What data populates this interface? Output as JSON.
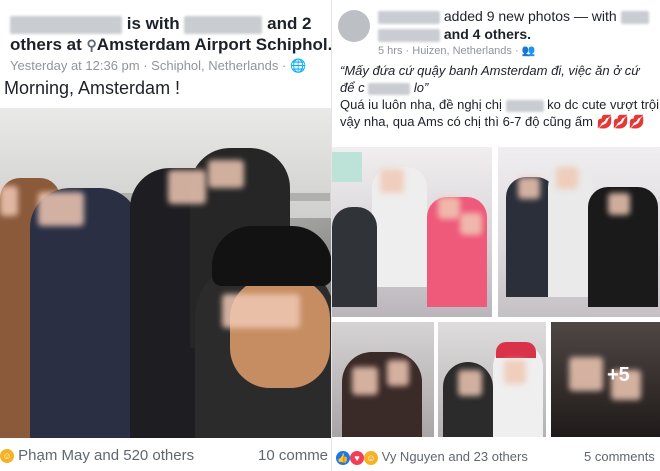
{
  "left_post": {
    "header_with": "is with",
    "header_and": "and 2",
    "header_others": "others at",
    "location": "Amsterdam Airport Schiphol.",
    "timestamp": "Yesterday at 12:36 pm",
    "place": "Schiphol, Netherlands",
    "body": "Morning, Amsterdam !",
    "reactions_text": "Phạm May and 520 others",
    "comments_text": "10 comme"
  },
  "right_post": {
    "header_added": "added 9 new photos — with",
    "header_others": "and 4 others.",
    "time": "5 hrs",
    "place": "Huizen, Netherlands",
    "body_line1": "“Mấy đứa cứ quậy banh Amsterdam đi, việc ăn ở cứ",
    "body_line2a": "để c",
    "body_line2b": "lo”",
    "body_line3a": "Quá iu luôn nha, đề nghị chị",
    "body_line3b": "ko dc cute vượt trội",
    "body_line4": "vậy nha, qua Ams có chị thì 6-7 độ cũng ấm 💋💋💋",
    "more_photos": "+5",
    "reactions_text": "Vy Nguyen and 23 others",
    "comments_text": "5 comments"
  },
  "icons": [
    "location-pin-icon",
    "globe-icon",
    "friends-icon",
    "like-icon",
    "love-icon",
    "haha-icon"
  ],
  "colors": {
    "meta": "#90949c",
    "text": "#1d2129",
    "like": "#1877f2",
    "love": "#f33e58",
    "haha": "#f7b125"
  }
}
